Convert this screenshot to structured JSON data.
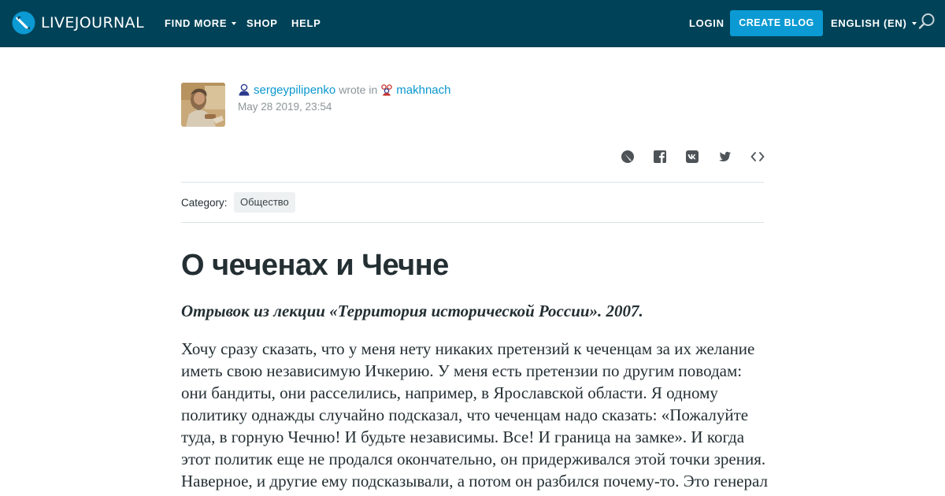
{
  "header": {
    "logo_text": "LIVEJOURNAL",
    "logo_icon": "livejournal-pencil-logo",
    "nav": {
      "find_more": "FIND MORE",
      "shop": "SHOP",
      "help": "HELP"
    },
    "login": "LOGIN",
    "create_blog": "CREATE BLOG",
    "language": "ENGLISH (EN)",
    "search_icon": "search-icon",
    "colors": {
      "bar": "#004359",
      "accent": "#0b9ad3"
    }
  },
  "post": {
    "author": "sergeypilipenko",
    "wrote_in": "wrote in",
    "community": "makhnach",
    "date": "May 28 2019, 23:54",
    "share_icons": [
      "livejournal-share-icon",
      "facebook-icon",
      "vk-icon",
      "twitter-icon",
      "embed-code-icon"
    ],
    "category_label": "Category:",
    "category": "Общество",
    "title": "О чеченах и Чечне",
    "lead": "Отрывок из лекции «Территория исторической России». 2007.",
    "body": "Хочу сразу сказать, что у меня нету никаких претензий к чеченцам за их желание иметь свою независимую Ичкерию. У меня есть претензии по другим поводам: они бандиты, они расселились, например, в Ярославской области. Я одному политику однажды случайно подсказал, что чеченцам надо сказать: «Пожалуйте туда, в горную Чечню! И будьте независимы. Все! И граница на замке». И когда этот политик еще не продался окончательно, он придерживался этой точки зрения. Наверное, и другие ему подсказывали, а потом он разбился почему-то. Это генерал Лебедь."
  }
}
